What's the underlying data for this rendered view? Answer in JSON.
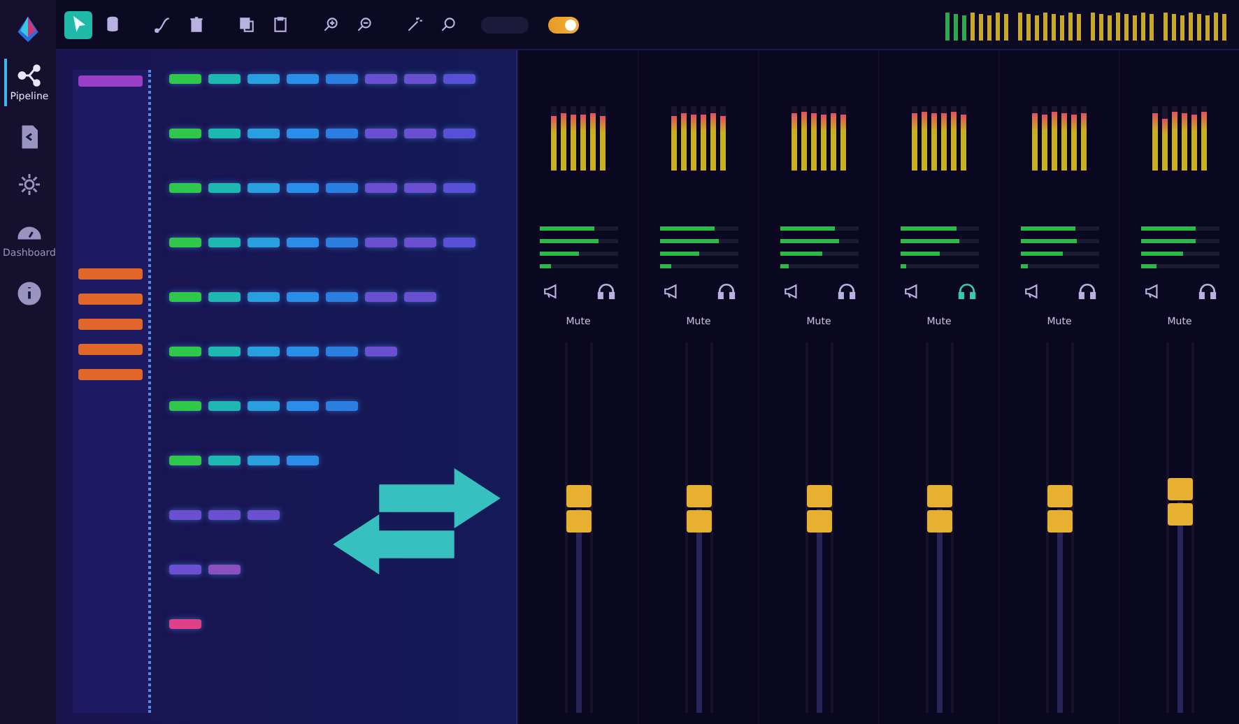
{
  "sidebar": {
    "items": [
      {
        "kind": "pipeline",
        "label": "Pipeline",
        "selected": true
      },
      {
        "kind": "file",
        "selected": false
      },
      {
        "kind": "settings",
        "selected": false
      },
      {
        "kind": "dashboard",
        "label": "Dashboard",
        "selected": false
      },
      {
        "kind": "info",
        "selected": false
      }
    ]
  },
  "toolbar": {
    "tools": [
      {
        "kind": "pointer",
        "selected": true
      },
      {
        "kind": "database",
        "selected": false
      },
      {
        "kind": "curve",
        "selected": false
      },
      {
        "kind": "trash",
        "selected": false
      },
      {
        "kind": "copy",
        "selected": false
      },
      {
        "kind": "paste",
        "selected": false
      },
      {
        "kind": "zoom-in",
        "selected": false
      },
      {
        "kind": "zoom-out",
        "selected": false
      },
      {
        "kind": "wand",
        "selected": false
      },
      {
        "kind": "search",
        "selected": false
      }
    ],
    "toggle": {
      "on": true
    }
  },
  "pipeline": {
    "inputs": [
      {
        "color": "#9a3fc8"
      },
      {
        "color": "#e0662a"
      },
      {
        "color": "#e0662a"
      },
      {
        "color": "#e0662a"
      },
      {
        "color": "#e0662a"
      },
      {
        "color": "#e0662a"
      }
    ],
    "rows": [
      {
        "nodes": [
          {
            "color": "#2fc84a"
          },
          {
            "color": "#1fb8b0"
          },
          {
            "color": "#2a9fe0"
          },
          {
            "color": "#2a8de8"
          },
          {
            "color": "#2a7fe0"
          },
          {
            "color": "#6a4fd0"
          },
          {
            "color": "#6a4fd0"
          },
          {
            "color": "#5a50d8"
          }
        ]
      },
      {
        "nodes": [
          {
            "color": "#2fc84a"
          },
          {
            "color": "#1fb8b0"
          },
          {
            "color": "#2a9fe0"
          },
          {
            "color": "#2a8de8"
          },
          {
            "color": "#2a7fe0"
          },
          {
            "color": "#6a4fd0"
          },
          {
            "color": "#6a4fd0"
          },
          {
            "color": "#5a50d8"
          }
        ]
      },
      {
        "nodes": [
          {
            "color": "#2fc84a"
          },
          {
            "color": "#1fb8b0"
          },
          {
            "color": "#2a9fe0"
          },
          {
            "color": "#2a8de8"
          },
          {
            "color": "#2a7fe0"
          },
          {
            "color": "#6a4fd0"
          },
          {
            "color": "#6a4fd0"
          },
          {
            "color": "#5a50d8"
          }
        ]
      },
      {
        "nodes": [
          {
            "color": "#2fc84a"
          },
          {
            "color": "#1fb8b0"
          },
          {
            "color": "#2a9fe0"
          },
          {
            "color": "#2a8de8"
          },
          {
            "color": "#2a7fe0"
          },
          {
            "color": "#6a4fd0"
          },
          {
            "color": "#6a4fd0"
          },
          {
            "color": "#5a50d8"
          }
        ]
      },
      {
        "nodes": [
          {
            "color": "#2fc84a"
          },
          {
            "color": "#1fb8b0"
          },
          {
            "color": "#2a9fe0"
          },
          {
            "color": "#2a8de8"
          },
          {
            "color": "#2a7fe0"
          },
          {
            "color": "#6a4fd0"
          },
          {
            "color": "#6a4fd0"
          }
        ]
      },
      {
        "nodes": [
          {
            "color": "#2fc84a"
          },
          {
            "color": "#1fb8b0"
          },
          {
            "color": "#2a9fe0"
          },
          {
            "color": "#2a8de8"
          },
          {
            "color": "#2a7fe0"
          },
          {
            "color": "#6a4fd0"
          }
        ]
      },
      {
        "nodes": [
          {
            "color": "#2fc84a"
          },
          {
            "color": "#1fb8b0"
          },
          {
            "color": "#2a9fe0"
          },
          {
            "color": "#2a8de8"
          },
          {
            "color": "#2a7fe0"
          }
        ]
      },
      {
        "nodes": [
          {
            "color": "#2fc84a"
          },
          {
            "color": "#1fb8b0"
          },
          {
            "color": "#2a9fe0"
          },
          {
            "color": "#2a8de8"
          }
        ]
      },
      {
        "nodes": [
          {
            "color": "#6a4fd0"
          },
          {
            "color": "#6a4fd0"
          },
          {
            "color": "#6a4fd0"
          }
        ]
      },
      {
        "nodes": [
          {
            "color": "#6a4fd0"
          },
          {
            "color": "#8a4fc0"
          }
        ]
      },
      {
        "nodes": [
          {
            "color": "#e0408a"
          }
        ]
      }
    ]
  },
  "mixer": {
    "channels": [
      {
        "meters": [
          {
            "level": 0.85
          },
          {
            "level": 0.9
          },
          {
            "level": 0.88
          },
          {
            "level": 0.86
          },
          {
            "level": 0.9
          },
          {
            "level": 0.84
          }
        ],
        "sends": [
          {
            "level": 0.7
          },
          {
            "level": 0.75
          },
          {
            "level": 0.5
          },
          {
            "level": 0.15
          }
        ],
        "monitor": false,
        "mute_label": "Mute",
        "fader": {
          "level": 0.55
        }
      },
      {
        "meters": [
          {
            "level": 0.85
          },
          {
            "level": 0.9
          },
          {
            "level": 0.88
          },
          {
            "level": 0.86
          },
          {
            "level": 0.9
          },
          {
            "level": 0.84
          }
        ],
        "sends": [
          {
            "level": 0.7
          },
          {
            "level": 0.75
          },
          {
            "level": 0.5
          },
          {
            "level": 0.15
          }
        ],
        "monitor": false,
        "mute_label": "Mute",
        "fader": {
          "level": 0.55
        }
      },
      {
        "meters": [
          {
            "level": 0.9
          },
          {
            "level": 0.92
          },
          {
            "level": 0.9
          },
          {
            "level": 0.88
          },
          {
            "level": 0.9
          },
          {
            "level": 0.88
          }
        ],
        "sends": [
          {
            "level": 0.7
          },
          {
            "level": 0.75
          },
          {
            "level": 0.55
          },
          {
            "level": 0.12
          }
        ],
        "monitor": false,
        "mute_label": "Mute",
        "fader": {
          "level": 0.55
        }
      },
      {
        "meters": [
          {
            "level": 0.9
          },
          {
            "level": 0.92
          },
          {
            "level": 0.9
          },
          {
            "level": 0.9
          },
          {
            "level": 0.92
          },
          {
            "level": 0.88
          }
        ],
        "sends": [
          {
            "level": 0.72
          },
          {
            "level": 0.75
          },
          {
            "level": 0.5
          },
          {
            "level": 0.08
          }
        ],
        "monitor": true,
        "mute_label": "Mute",
        "fader": {
          "level": 0.55
        }
      },
      {
        "meters": [
          {
            "level": 0.9
          },
          {
            "level": 0.88
          },
          {
            "level": 0.92
          },
          {
            "level": 0.9
          },
          {
            "level": 0.88
          },
          {
            "level": 0.9
          }
        ],
        "sends": [
          {
            "level": 0.7
          },
          {
            "level": 0.72
          },
          {
            "level": 0.55
          },
          {
            "level": 0.1
          }
        ],
        "monitor": false,
        "mute_label": "Mute",
        "fader": {
          "level": 0.55
        }
      },
      {
        "meters": [
          {
            "level": 0.9
          },
          {
            "level": 0.8
          },
          {
            "level": 0.92
          },
          {
            "level": 0.9
          },
          {
            "level": 0.88
          },
          {
            "level": 0.92
          }
        ],
        "sends": [
          {
            "level": 0.7
          },
          {
            "level": 0.7
          },
          {
            "level": 0.55
          },
          {
            "level": 0.2
          }
        ],
        "monitor": false,
        "mute_label": "Mute",
        "fader": {
          "level": 0.57
        }
      }
    ]
  }
}
